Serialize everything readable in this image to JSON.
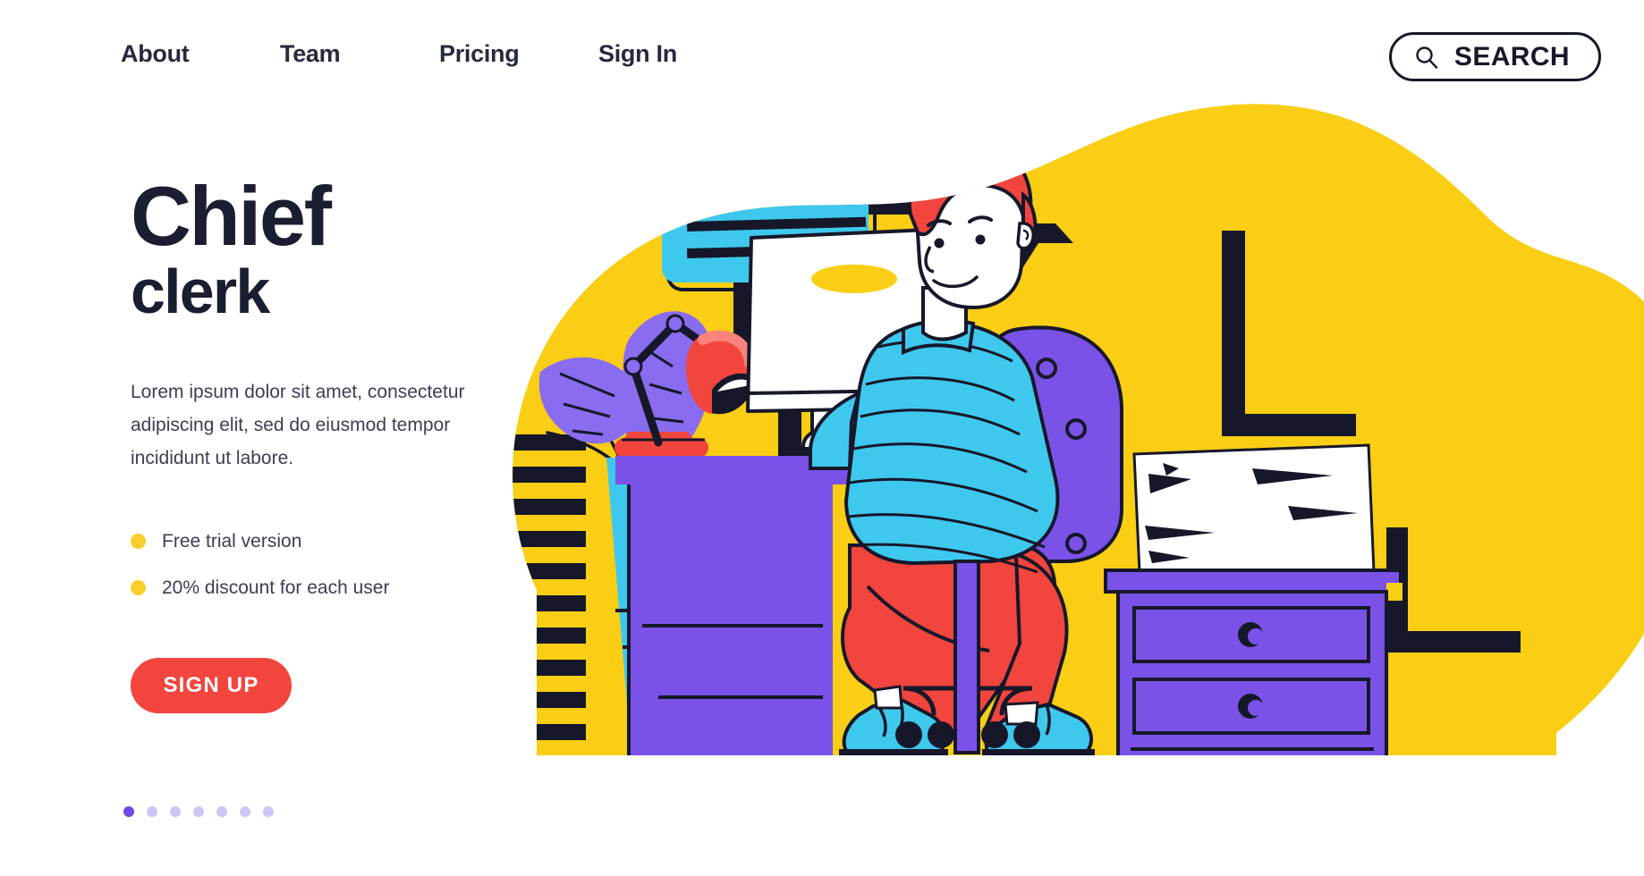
{
  "nav": {
    "links": [
      {
        "label": "About",
        "name": "nav-link-about"
      },
      {
        "label": "Team",
        "name": "nav-link-team"
      },
      {
        "label": "Pricing",
        "name": "nav-link-pricing"
      },
      {
        "label": "Sign In",
        "name": "nav-link-sign-in"
      }
    ],
    "search_label": "SEARCH",
    "search_icon": "search-icon"
  },
  "hero": {
    "title_main": "Chief",
    "title_sub": "clerk",
    "lead": "Lorem ipsum dolor sit amet, consectetur adipiscing elit, sed do eiusmod tempor incididunt ut labore.",
    "features": [
      "Free trial version",
      "20% discount for each user"
    ],
    "cta_label": "SIGN UP"
  },
  "carousel": {
    "total_dots": 7,
    "active_index": 0
  },
  "colors": {
    "yellow": "#F9CE14",
    "cyan": "#3FC8EE",
    "purple": "#7B52E8",
    "lavender": "#8A6CF0",
    "red": "#F2453D",
    "dark": "#16182A",
    "amber_bullet": "#F9CE2A",
    "dot_active": "#6A4CE4",
    "dot_inactive": "#CDC6F5",
    "white": "#FFFFFF"
  },
  "illustration": {
    "name": "office-worker-illustration",
    "elements": [
      "yellow-blob-background",
      "speech-bubble",
      "desk-lamp",
      "monitor",
      "desk",
      "potted-plant",
      "striped-panel",
      "person",
      "office-chair",
      "nightstand",
      "paper-stack",
      "ceiling-lamp"
    ]
  }
}
